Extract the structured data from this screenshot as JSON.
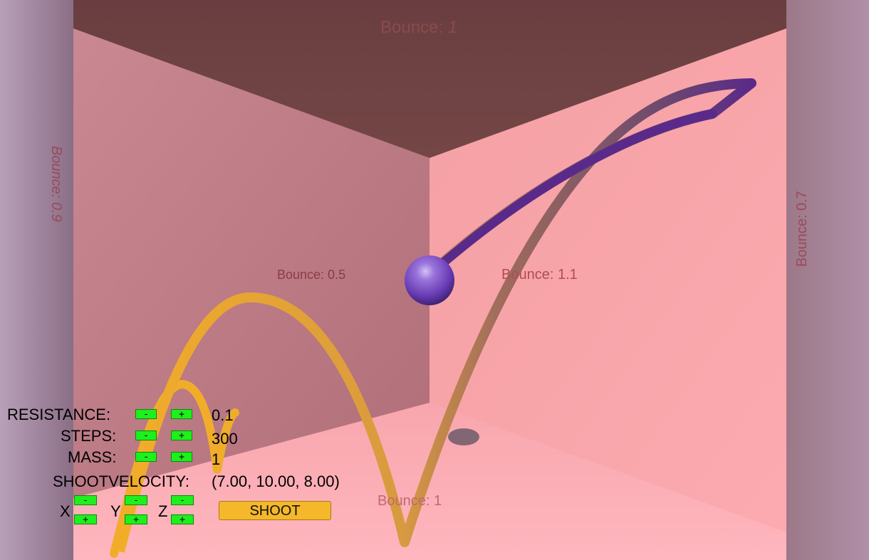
{
  "walls": {
    "ceiling_label": "Bounce: ",
    "ceiling_value": "1",
    "back_left_label": "Bounce: 0.5",
    "back_right_label": "Bounce: 1.1",
    "floor_label": "Bounce: 1",
    "left_label": "Bounce: 0.9",
    "right_label": "Bounce: 0.7"
  },
  "controls": {
    "resistance_label": "RESISTANCE:",
    "resistance_value": "0.1",
    "steps_label": "STEPS:",
    "steps_value": "300",
    "mass_label": "MASS:",
    "mass_value": "1",
    "minus": "-",
    "plus": "+",
    "shootvelocity_label": "SHOOTVELOCITY:",
    "shootvelocity_value": "(7.00, 10.00, 8.00)",
    "x_label": "X",
    "y_label": "Y",
    "z_label": "Z",
    "shoot_label": "SHOOT"
  },
  "colors": {
    "ceiling": "#6f4242",
    "back_left_wall": "#c07c85",
    "back_right_wall": "#f7a0a2",
    "floor": "#f7a8ae",
    "side_walls": "#a08098",
    "ball": "#7a54c0",
    "trail_orange": "#f0aa2a",
    "trail_purple": "#5b2a8a",
    "button_green": "#1df01d",
    "shoot_button": "#f4b82a"
  }
}
